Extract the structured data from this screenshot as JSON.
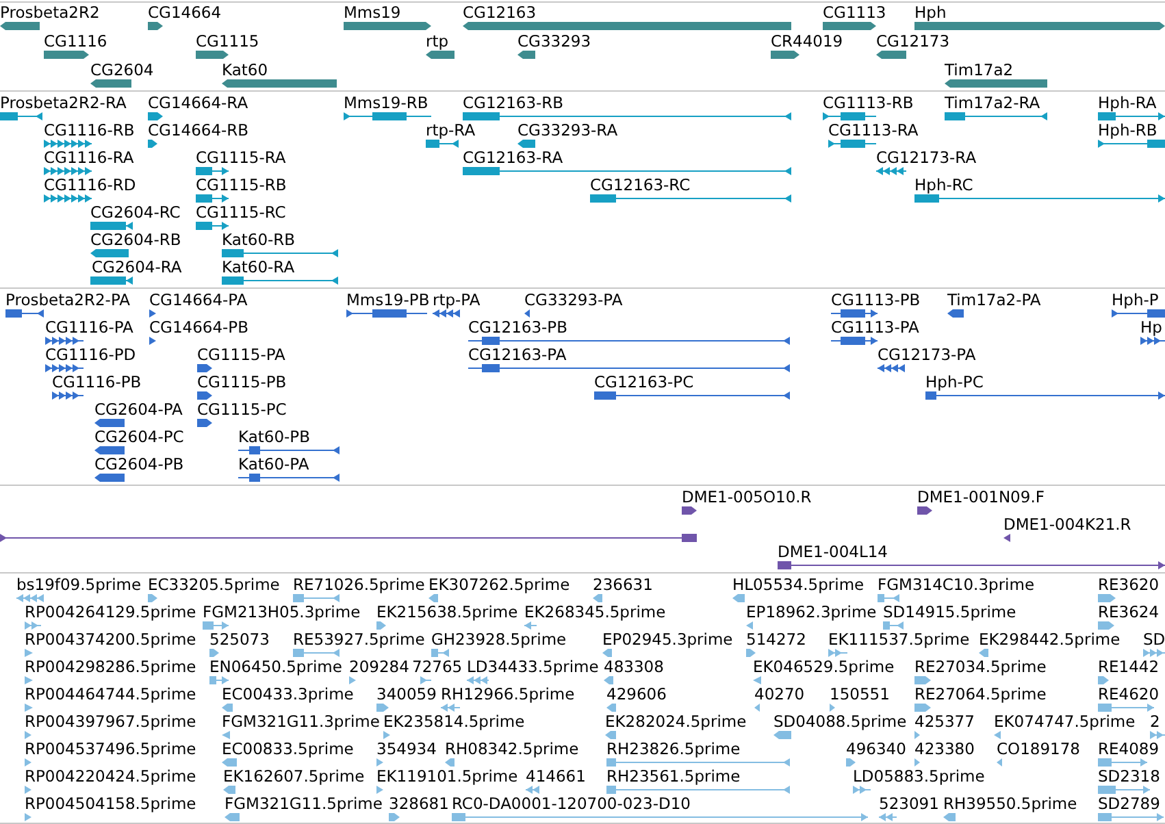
{
  "tracks": [
    {
      "kind": "gene",
      "features": [
        {
          "label": "Prosbeta2R2",
          "reverse": true
        },
        {
          "label": "CG14664",
          "reverse": false
        },
        {
          "label": "Mms19",
          "reverse": false
        },
        {
          "label": "CG12163",
          "reverse": true
        },
        {
          "label": "CG1113",
          "reverse": false
        },
        {
          "label": "Hph",
          "reverse": false
        },
        {
          "label": "CG1116",
          "reverse": false
        },
        {
          "label": "CG1115",
          "reverse": false
        },
        {
          "label": "rtp",
          "reverse": true
        },
        {
          "label": "CG33293",
          "reverse": true
        },
        {
          "label": "CR44019",
          "reverse": false
        },
        {
          "label": "CG12173",
          "reverse": true
        },
        {
          "label": "CG2604",
          "reverse": true
        },
        {
          "label": "Kat60",
          "reverse": true
        },
        {
          "label": "Tim17a2",
          "reverse": true
        }
      ]
    },
    {
      "kind": "transcript",
      "features": [
        {
          "label": "Prosbeta2R2-RA",
          "reverse": true
        },
        {
          "label": "CG14664-RA",
          "reverse": false
        },
        {
          "label": "Mms19-RB",
          "reverse": false
        },
        {
          "label": "CG12163-RB",
          "reverse": true
        },
        {
          "label": "CG1113-RB",
          "reverse": false
        },
        {
          "label": "Tim17a2-RA",
          "reverse": true
        },
        {
          "label": "Hph-RA",
          "reverse": false
        },
        {
          "label": "CG1116-RB",
          "reverse": false
        },
        {
          "label": "CG14664-RB",
          "reverse": false
        },
        {
          "label": "rtp-RA",
          "reverse": true
        },
        {
          "label": "CG33293-RA",
          "reverse": true
        },
        {
          "label": "CG1113-RA",
          "reverse": false
        },
        {
          "label": "Hph-RB",
          "reverse": false
        },
        {
          "label": "CG1116-RA",
          "reverse": false
        },
        {
          "label": "CG1115-RA",
          "reverse": false
        },
        {
          "label": "CG12163-RA",
          "reverse": true
        },
        {
          "label": "CG12173-RA",
          "reverse": true
        },
        {
          "label": "CG1116-RD",
          "reverse": false
        },
        {
          "label": "CG1115-RB",
          "reverse": false
        },
        {
          "label": "CG12163-RC",
          "reverse": true
        },
        {
          "label": "Hph-RC",
          "reverse": false
        },
        {
          "label": "CG2604-RC",
          "reverse": true
        },
        {
          "label": "CG1115-RC",
          "reverse": false
        },
        {
          "label": "CG2604-RB",
          "reverse": true
        },
        {
          "label": "Kat60-RB",
          "reverse": true
        },
        {
          "label": "CG2604-RA",
          "reverse": true
        },
        {
          "label": "Kat60-RA",
          "reverse": true
        }
      ]
    },
    {
      "kind": "protein",
      "features": [
        {
          "label": "Prosbeta2R2-PA",
          "reverse": true
        },
        {
          "label": "CG14664-PA",
          "reverse": false
        },
        {
          "label": "Mms19-PB",
          "reverse": false
        },
        {
          "label": "rtp-PA",
          "reverse": true
        },
        {
          "label": "CG33293-PA",
          "reverse": true
        },
        {
          "label": "CG1113-PB",
          "reverse": false
        },
        {
          "label": "Tim17a2-PA",
          "reverse": true
        },
        {
          "label": "Hph-P",
          "reverse": false
        },
        {
          "label": "CG1116-PA",
          "reverse": false
        },
        {
          "label": "CG14664-PB",
          "reverse": false
        },
        {
          "label": "CG12163-PB",
          "reverse": true
        },
        {
          "label": "CG1113-PA",
          "reverse": false
        },
        {
          "label": "Hp",
          "reverse": false
        },
        {
          "label": "CG1116-PD",
          "reverse": false
        },
        {
          "label": "CG1115-PA",
          "reverse": false
        },
        {
          "label": "CG12163-PA",
          "reverse": true
        },
        {
          "label": "CG12173-PA",
          "reverse": true
        },
        {
          "label": "CG1116-PB",
          "reverse": false
        },
        {
          "label": "CG1115-PB",
          "reverse": false
        },
        {
          "label": "CG12163-PC",
          "reverse": true
        },
        {
          "label": "Hph-PC",
          "reverse": false
        },
        {
          "label": "CG2604-PA",
          "reverse": true
        },
        {
          "label": "CG1115-PC",
          "reverse": false
        },
        {
          "label": "CG2604-PC",
          "reverse": true
        },
        {
          "label": "Kat60-PB",
          "reverse": true
        },
        {
          "label": "CG2604-PB",
          "reverse": true
        },
        {
          "label": "Kat60-PA",
          "reverse": true
        }
      ]
    },
    {
      "kind": "clone",
      "features": [
        {
          "label": "DME1-005O10.R",
          "reverse": false
        },
        {
          "label": "DME1-001N09.F",
          "reverse": false
        },
        {
          "reverse": false
        },
        {
          "label": "DME1-004K21.R",
          "reverse": true
        },
        {
          "label": "DME1-004L14",
          "reverse": false
        }
      ]
    },
    {
      "kind": "est",
      "features": [
        {
          "label": "bs19f09.5prime",
          "reverse": true
        },
        {
          "label": "EC33205.5prime",
          "reverse": false
        },
        {
          "label": "RE71026.5prime",
          "reverse": true
        },
        {
          "label": "EK307262.5prime",
          "reverse": true
        },
        {
          "label": "236631",
          "reverse": true
        },
        {
          "label": "HL05534.5prime",
          "reverse": true
        },
        {
          "label": "FGM314C10.3prime",
          "reverse": true
        },
        {
          "label": "RE3620",
          "reverse": false
        },
        {
          "label": "RP004264129.5prime",
          "reverse": false
        },
        {
          "label": "FGM213H05.3prime",
          "reverse": false
        },
        {
          "label": "EK215638.5prime",
          "reverse": false
        },
        {
          "label": "EK268345.5prime",
          "reverse": true
        },
        {
          "label": "EP18962.3prime",
          "reverse": true
        },
        {
          "label": "SD14915.5prime",
          "reverse": true
        },
        {
          "label": "RE3624",
          "reverse": false
        },
        {
          "label": "RP004374200.5prime",
          "reverse": false
        },
        {
          "label": "525073",
          "reverse": false
        },
        {
          "label": "RE53927.5prime",
          "reverse": true
        },
        {
          "label": "GH23928.5prime",
          "reverse": true
        },
        {
          "label": "EP02945.3prime",
          "reverse": true
        },
        {
          "label": "514272",
          "reverse": false
        },
        {
          "label": "EK111537.5prime",
          "reverse": false
        },
        {
          "label": "EK298442.5prime",
          "reverse": true
        },
        {
          "label": "SD",
          "reverse": false
        },
        {
          "label": "RP004298286.5prime",
          "reverse": false
        },
        {
          "label": "EN06450.5prime",
          "reverse": false
        },
        {
          "label": "209284",
          "reverse": false
        },
        {
          "label": "72765",
          "reverse": false
        },
        {
          "label": "LD34433.5prime",
          "reverse": true
        },
        {
          "label": "483308",
          "reverse": true
        },
        {
          "label": "EK046529.5prime",
          "reverse": true
        },
        {
          "label": "RE27034.5prime",
          "reverse": false
        },
        {
          "label": "RE1442",
          "reverse": false
        },
        {
          "label": "RP004464744.5prime",
          "reverse": false
        },
        {
          "label": "EC00433.3prime",
          "reverse": true
        },
        {
          "label": "340059",
          "reverse": false
        },
        {
          "label": "RH12966.5prime",
          "reverse": true
        },
        {
          "label": "429606",
          "reverse": true
        },
        {
          "label": "40270",
          "reverse": true
        },
        {
          "label": "150551",
          "reverse": false
        },
        {
          "label": "RE27064.5prime",
          "reverse": false
        },
        {
          "label": "RE4620",
          "reverse": false
        },
        {
          "label": "RP004397967.5prime",
          "reverse": false
        },
        {
          "label": "FGM321G11.3prime",
          "reverse": true
        },
        {
          "label": "EK235814.5prime",
          "reverse": false
        },
        {
          "label": "EK282024.5prime",
          "reverse": true
        },
        {
          "label": "SD04088.5prime",
          "reverse": true
        },
        {
          "label": "425377",
          "reverse": false
        },
        {
          "label": "EK074747.5prime",
          "reverse": true
        },
        {
          "label": "2",
          "reverse": false
        },
        {
          "label": "RP004537496.5prime",
          "reverse": false
        },
        {
          "label": "EC00833.5prime",
          "reverse": true
        },
        {
          "label": "354934",
          "reverse": false
        },
        {
          "label": "RH08342.5prime",
          "reverse": true
        },
        {
          "label": "RH23826.5prime",
          "reverse": true
        },
        {
          "label": "496340",
          "reverse": false
        },
        {
          "label": "423380",
          "reverse": false
        },
        {
          "label": "CO189178",
          "reverse": true
        },
        {
          "label": "RE4089",
          "reverse": false
        },
        {
          "label": "RP004220424.5prime",
          "reverse": false
        },
        {
          "label": "EK162607.5prime",
          "reverse": true
        },
        {
          "label": "EK119101.5prime",
          "reverse": false
        },
        {
          "label": "414661",
          "reverse": true
        },
        {
          "label": "RH23561.5prime",
          "reverse": true
        },
        {
          "label": "LD05883.5prime",
          "reverse": false
        },
        {
          "label": "SD2318",
          "reverse": false
        },
        {
          "label": "RP004504158.5prime",
          "reverse": false
        },
        {
          "label": "FGM321G11.5prime",
          "reverse": true
        },
        {
          "label": "328681",
          "reverse": false
        },
        {
          "label": "RC0-DA0001-120700-023-D10",
          "reverse": false
        },
        {
          "label": "523091",
          "reverse": true
        },
        {
          "label": "RH39550.5prime",
          "reverse": true
        },
        {
          "label": "SD2789",
          "reverse": false
        }
      ]
    }
  ]
}
